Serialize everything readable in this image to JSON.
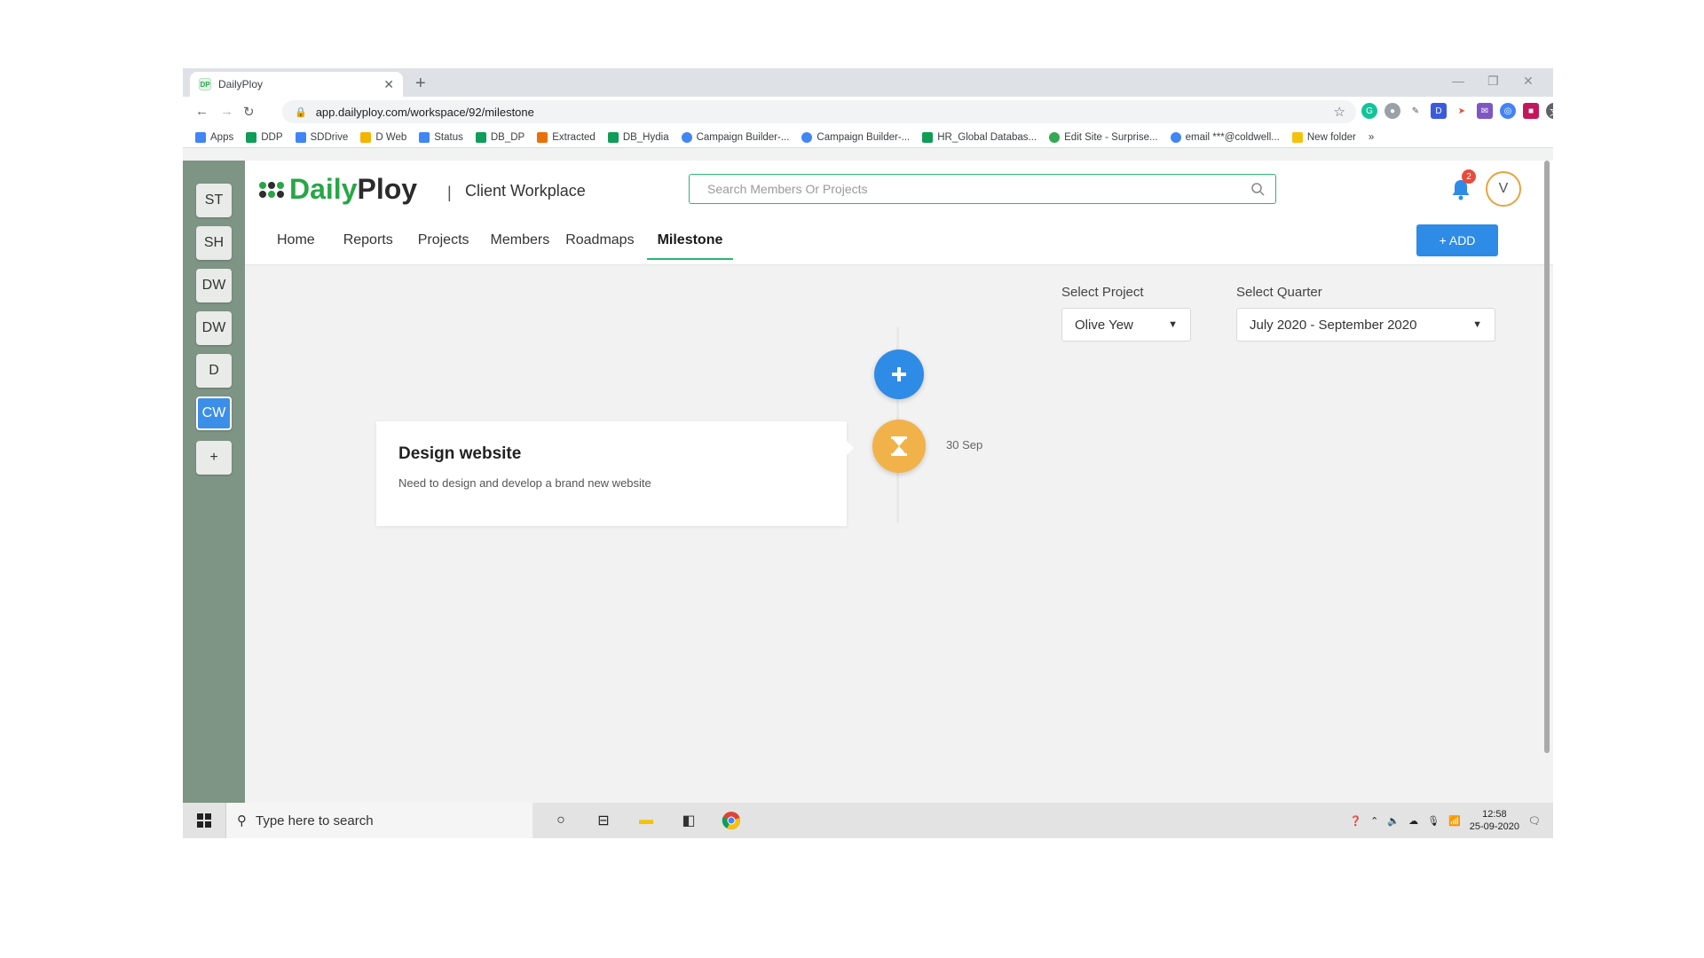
{
  "browser": {
    "tab_title": "DailyPloy",
    "tab_favicon": "DP",
    "url": "app.dailyploy.com/workspace/92/milestone",
    "bookmarks": [
      {
        "label": "Apps",
        "color": "#4285f4"
      },
      {
        "label": "DDP",
        "color": "#0f9d58"
      },
      {
        "label": "SDDrive",
        "color": "#4285f4"
      },
      {
        "label": "D Web",
        "color": "#f4b400"
      },
      {
        "label": "Status",
        "color": "#4285f4"
      },
      {
        "label": "DB_DP",
        "color": "#0f9d58"
      },
      {
        "label": "Extracted",
        "color": "#e8710a"
      },
      {
        "label": "DB_Hydia",
        "color": "#0f9d58"
      },
      {
        "label": "Campaign Builder-...",
        "color": "#4285f4"
      },
      {
        "label": "Campaign Builder-...",
        "color": "#4285f4"
      },
      {
        "label": "HR_Global Databas...",
        "color": "#0f9d58"
      },
      {
        "label": "Edit Site - Surprise...",
        "color": "#34a853"
      },
      {
        "label": "email ***@coldwell...",
        "color": "#4285f4"
      },
      {
        "label": "New folder",
        "color": "#f4c20d"
      }
    ],
    "bookmarks_more": "»"
  },
  "workspaces": [
    {
      "label": "ST",
      "active": false
    },
    {
      "label": "SH",
      "active": false
    },
    {
      "label": "DW",
      "active": false
    },
    {
      "label": "DW",
      "active": false
    },
    {
      "label": "D",
      "active": false
    },
    {
      "label": "CW",
      "active": true
    },
    {
      "label": "+",
      "active": false
    }
  ],
  "header": {
    "logo_daily": "Daily",
    "logo_ploy": "Ploy",
    "separator": "|",
    "workspace_name": "Client Workplace",
    "search_placeholder": "Search Members Or Projects",
    "notification_count": "2",
    "avatar_initial": "V"
  },
  "nav": {
    "tabs": [
      {
        "label": "Home",
        "active": false
      },
      {
        "label": "Reports",
        "active": false
      },
      {
        "label": "Projects",
        "active": false
      },
      {
        "label": "Members",
        "active": false
      },
      {
        "label": "Roadmaps",
        "active": false
      },
      {
        "label": "Milestone",
        "active": true
      }
    ],
    "add_label": "+ ADD"
  },
  "filters": {
    "project_label": "Select Project",
    "project_value": "Olive Yew",
    "quarter_label": "Select Quarter",
    "quarter_value": "July 2020 - September 2020"
  },
  "milestone": {
    "title": "Design website",
    "description": "Need to design and develop a brand new website",
    "date": "30 Sep"
  },
  "taskbar": {
    "search_placeholder": "Type here to search",
    "time": "12:58",
    "date": "25-09-2020"
  },
  "colors": {
    "brand_green": "#27a745",
    "accent_blue": "#2e8be6",
    "pending_orange": "#f2b24a",
    "sidebar_green": "#7e9485"
  }
}
